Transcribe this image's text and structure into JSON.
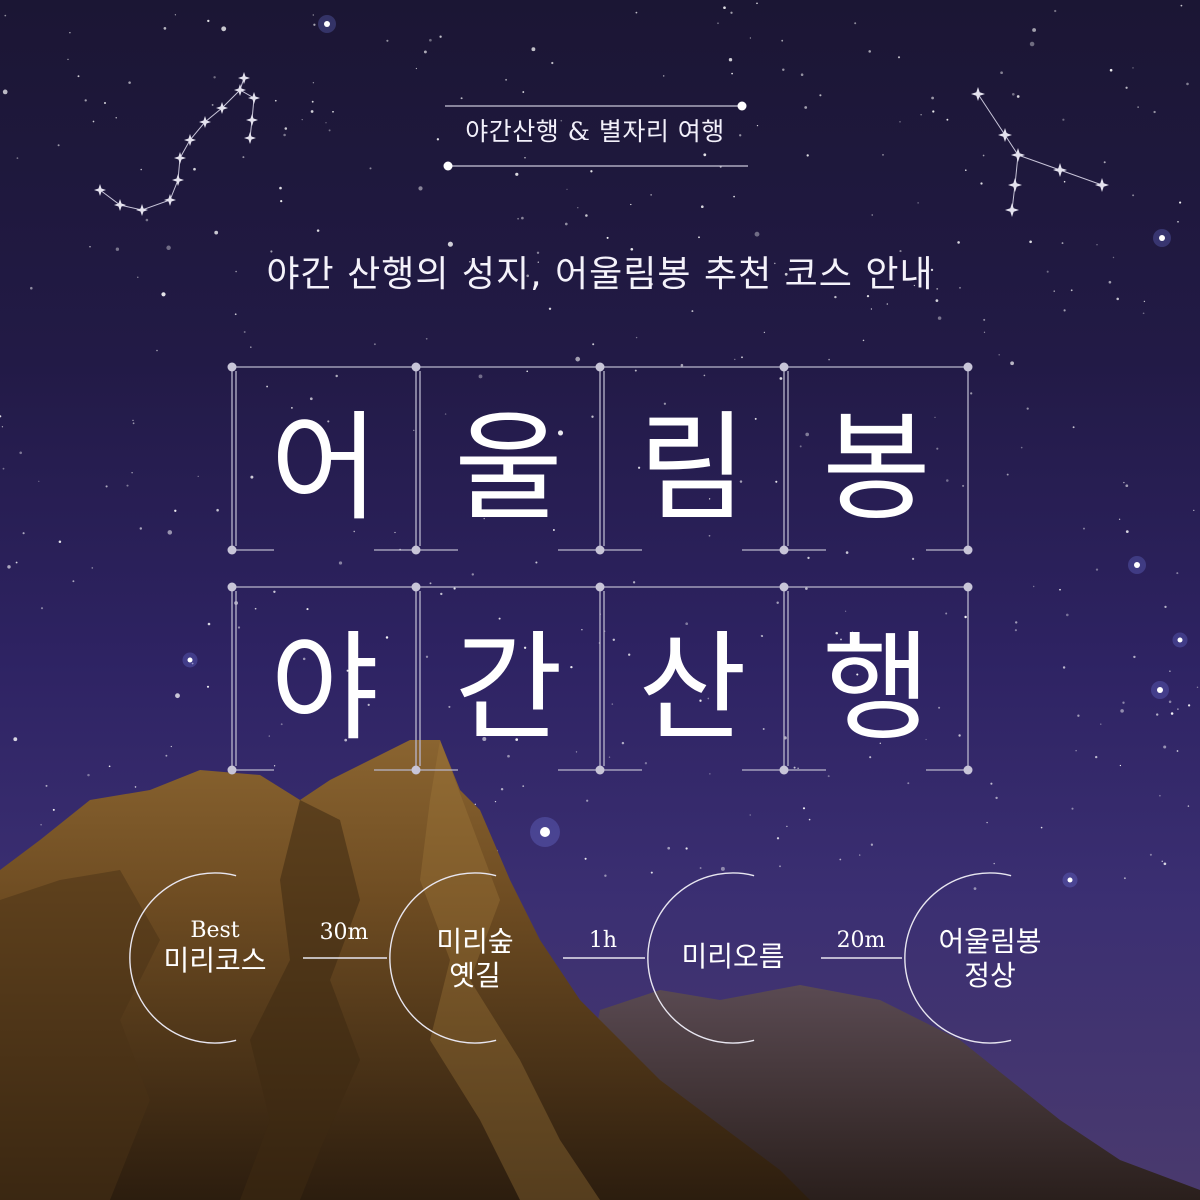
{
  "header": {
    "tag": "야간산행 & 별자리 여행"
  },
  "subtitle": "야간 산행의 성지, 어울림봉 추천 코스 안내",
  "title": {
    "row1": [
      "어",
      "울",
      "림",
      "봉"
    ],
    "row2": [
      "야",
      "간",
      "산",
      "행"
    ]
  },
  "course": {
    "stops": [
      {
        "best": "Best",
        "name": "미리코스"
      },
      {
        "name": "미리숲\n옛길"
      },
      {
        "name": "미리오름"
      },
      {
        "name": "어울림봉\n정상"
      }
    ],
    "durations": [
      "30m",
      "1h",
      "20m"
    ]
  },
  "colors": {
    "sky_top": "#1b1634",
    "sky_bottom": "#3b2f72",
    "rock": "#6b4a22",
    "line": "#b9b6cc"
  }
}
